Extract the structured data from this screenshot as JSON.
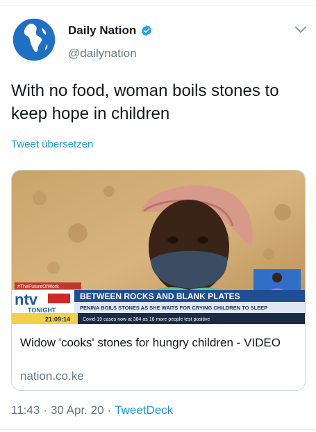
{
  "account": {
    "display_name": "Daily Nation",
    "handle": "@dailynation",
    "verified": true
  },
  "tweet": {
    "text": "With no food, woman boils stones to keep hope in children",
    "translate_label": "Tweet übersetzen"
  },
  "card": {
    "title": "Widow 'cooks' stones for hungry children - VIDEO",
    "domain": "nation.co.ke",
    "media": {
      "channel_logo": "ntv",
      "channel_sub": "TONIGHT",
      "hashtag": "#TheFutureOfWork",
      "headline": "BETWEEN ROCKS AND BLANK PLATES",
      "subheadline": "PENINA BOILS STONES AS SHE WAITS FOR CRYING CHILDREN TO SLEEP",
      "clock": "21:09:14",
      "ticker": "Covid-19 cases now at 384 as 16 more people test positive"
    }
  },
  "meta": {
    "time": "11:43",
    "separator": "·",
    "date": "30 Apr. 20",
    "source": "TweetDeck"
  },
  "colors": {
    "link": "#1b95e0",
    "secondary": "#657786",
    "border": "#ccd6dd"
  }
}
